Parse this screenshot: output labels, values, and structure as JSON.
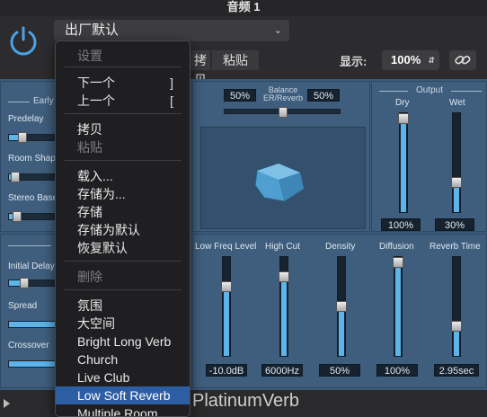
{
  "window": {
    "title": "音频 1"
  },
  "header": {
    "preset_name": "出厂默认",
    "copy_label": "拷贝",
    "paste_label": "粘贴",
    "display_label": "显示:",
    "zoom_value": "100%"
  },
  "menu": {
    "items": [
      {
        "label": "设置",
        "shortcut": "",
        "disabled": true
      },
      {
        "label": "下一个",
        "shortcut": "]",
        "disabled": false
      },
      {
        "label": "上一个",
        "shortcut": "[",
        "disabled": false
      },
      {
        "label": "拷贝",
        "shortcut": "",
        "disabled": false
      },
      {
        "label": "粘贴",
        "shortcut": "",
        "disabled": true
      },
      {
        "label": "载入...",
        "shortcut": "",
        "disabled": false
      },
      {
        "label": "存储为...",
        "shortcut": "",
        "disabled": false
      },
      {
        "label": "存储",
        "shortcut": "",
        "disabled": false
      },
      {
        "label": "存储为默认",
        "shortcut": "",
        "disabled": false
      },
      {
        "label": "恢复默认",
        "shortcut": "",
        "disabled": false
      },
      {
        "label": "删除",
        "shortcut": "",
        "disabled": true
      },
      {
        "label": "氛围",
        "shortcut": "",
        "disabled": false
      },
      {
        "label": "大空间",
        "shortcut": "",
        "disabled": false
      },
      {
        "label": "Bright Long Verb",
        "shortcut": "",
        "disabled": false
      },
      {
        "label": "Church",
        "shortcut": "",
        "disabled": false
      },
      {
        "label": "Live Club",
        "shortcut": "",
        "disabled": false
      },
      {
        "label": "Low Soft Reverb",
        "shortcut": "",
        "disabled": false,
        "selected": true
      },
      {
        "label": "Multiple Room",
        "shortcut": "",
        "disabled": false
      }
    ]
  },
  "early": {
    "section_title": "Early",
    "predelay_label": "Predelay",
    "room_shape_label": "Room Shape",
    "stereo_base_label": "Stereo Base",
    "reflection_section_title": "R",
    "initial_delay_label": "Initial Delay",
    "spread_label": "Spread",
    "crossover_label": "Crossover"
  },
  "balance": {
    "title": "Balance",
    "subtitle": "ER/Reverb",
    "left_value": "50%",
    "right_value": "50%",
    "level": 0.5
  },
  "output": {
    "title": "Output",
    "dry_label": "Dry",
    "wet_label": "Wet",
    "dry_value": "100%",
    "wet_value": "30%",
    "dry_level": 1.0,
    "wet_level": 0.3
  },
  "reverb": {
    "low_freq_level_label": "Low Freq Level",
    "high_cut_label": "High Cut",
    "density_label": "Density",
    "diffusion_label": "Diffusion",
    "reverb_time_label": "Reverb Time",
    "low_freq_level_value": "-10.0dB",
    "high_cut_value": "6000Hz",
    "density_value": "50%",
    "diffusion_value": "100%",
    "reverb_time_value": "2.95sec",
    "low_freq_level_level": 0.7,
    "high_cut_level": 0.8,
    "density_level": 0.5,
    "diffusion_level": 1.0,
    "reverb_time_level": 0.3
  },
  "footer": {
    "brand": "PlatinumVerb"
  },
  "colors": {
    "accent": "#5cb4ea",
    "menu_selected": "#2d5da3",
    "plugin_body": "#3c5a78"
  }
}
